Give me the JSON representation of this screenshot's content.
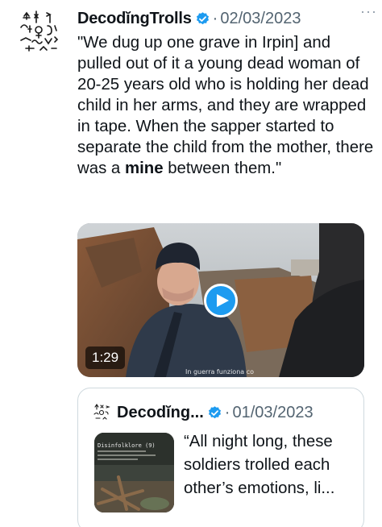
{
  "author": {
    "display_name": "DecodĭngTrolls",
    "verified_icon": "verified-badge-icon",
    "separator": "·",
    "date": "02/03/2023",
    "more_icon": "more-options-icon"
  },
  "tweet": {
    "text_before": "\"We dug up one grave in Irpin] and pulled out of it a young dead woman of 20-25 years old who is holding her dead child in her arms, and they are wrapped in tape. When the sapper started to separate the child from the mother, there was a ",
    "text_bold": "mine",
    "text_after": " between them.\""
  },
  "video": {
    "duration": "1:29",
    "play_icon": "play-icon",
    "watermark": "In guerra funziona co"
  },
  "quoted": {
    "display_name": "Decodĭng...",
    "separator": "·",
    "date": "01/03/2023",
    "thumbnail_title": "Disinfolklore (9)",
    "text": "“All night long, these soldiers trolled each other’s emotions, li..."
  },
  "colors": {
    "verified_blue": "#1d9bf0",
    "muted_text": "#536471",
    "border": "#cfd9de"
  }
}
